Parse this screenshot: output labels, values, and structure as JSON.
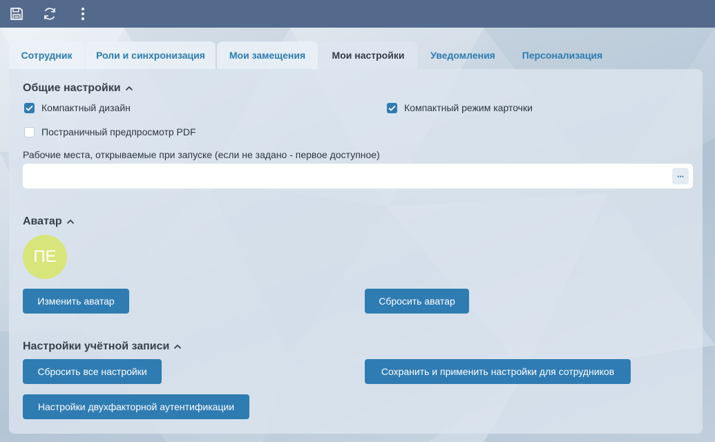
{
  "toolbar": {
    "save_icon": "save-icon",
    "refresh_icon": "refresh-icon",
    "more_icon": "more-vertical-icon"
  },
  "tabs": [
    {
      "label": "Сотрудник"
    },
    {
      "label": "Роли и синхронизация"
    },
    {
      "label": "Мои замещения"
    },
    {
      "label": "Мои настройки",
      "active": true
    },
    {
      "label": "Уведомления"
    },
    {
      "label": "Персонализация"
    }
  ],
  "general": {
    "title": "Общие настройки",
    "compact_design": {
      "label": "Компактный дизайн",
      "checked": true
    },
    "compact_card": {
      "label": "Компактный режим карточки",
      "checked": true
    },
    "pdf_preview": {
      "label": "Постраничный предпросмотр PDF",
      "checked": false
    },
    "workplaces_label": "Рабочие места, открываемые при запуске (если не задано - первое доступное)",
    "workplaces_value": "",
    "workplaces_button": "···"
  },
  "avatar": {
    "title": "Аватар",
    "initials": "ПЕ",
    "change_label": "Изменить аватар",
    "reset_label": "Сбросить аватар"
  },
  "account": {
    "title": "Настройки учётной записи",
    "reset_all_label": "Сбросить все настройки",
    "save_apply_label": "Сохранить и применить настройки для сотрудников",
    "two_factor_label": "Настройки двухфакторной аутентификации"
  },
  "colors": {
    "header": "#536a8d",
    "accent": "#2f7cb2",
    "avatar": "#d8e57a"
  }
}
